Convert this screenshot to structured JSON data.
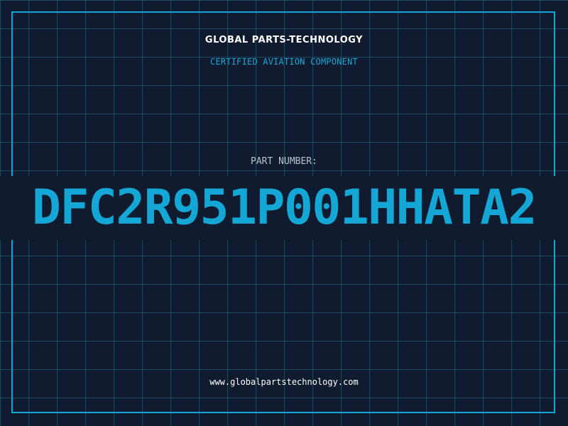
{
  "header": {
    "company_name": "GLOBAL PARTS-TECHNOLOGY",
    "tagline": "CERTIFIED AVIATION COMPONENT"
  },
  "part": {
    "label": "PART NUMBER:",
    "number": "DFC2R951P001HHATA2"
  },
  "footer": {
    "website": "www.globalpartstechnology.com"
  },
  "colors": {
    "background": "#101b2f",
    "grid": "#286e8c",
    "accent": "#14a6d4",
    "text_light": "#ffffff",
    "text_muted": "#b7c3cf"
  }
}
